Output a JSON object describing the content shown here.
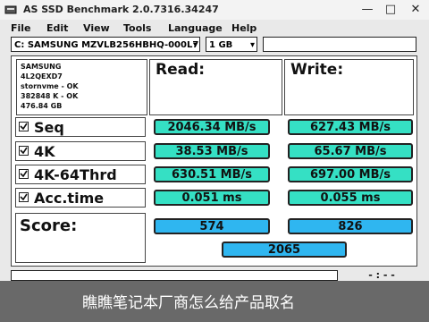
{
  "window": {
    "title": "AS SSD Benchmark 2.0.7316.34247",
    "buttons": {
      "minimize": "—",
      "maximize": "□",
      "close": "✕"
    }
  },
  "menu": [
    "File",
    "Edit",
    "View",
    "Tools",
    "Language",
    "Help"
  ],
  "drive_select": "C: SAMSUNG MZVLB256HBHQ-000L7",
  "size_select": "1 GB",
  "drive_info": [
    "SAMSUNG",
    "4L2QEXD7",
    "stornvme - OK",
    "382848 K - OK",
    "476.84 GB"
  ],
  "headers": {
    "read": "Read:",
    "write": "Write:"
  },
  "tests": [
    {
      "label": "Seq",
      "checked": true,
      "read": "2046.34 MB/s",
      "write": "627.43 MB/s"
    },
    {
      "label": "4K",
      "checked": true,
      "read": "38.53 MB/s",
      "write": "65.67 MB/s"
    },
    {
      "label": "4K-64Thrd",
      "checked": true,
      "read": "630.51 MB/s",
      "write": "697.00 MB/s"
    },
    {
      "label": "Acc.time",
      "checked": true,
      "read": "0.051 ms",
      "write": "0.055 ms"
    }
  ],
  "score": {
    "label": "Score:",
    "read": "574",
    "write": "826",
    "total": "2065"
  },
  "progress": 0.0,
  "overlay": {
    "text": "瞧瞧笔记本厂商怎么给产品取名"
  },
  "colors": {
    "result_fill": "#35e0c4",
    "score_fill": "#2fb6f0"
  }
}
